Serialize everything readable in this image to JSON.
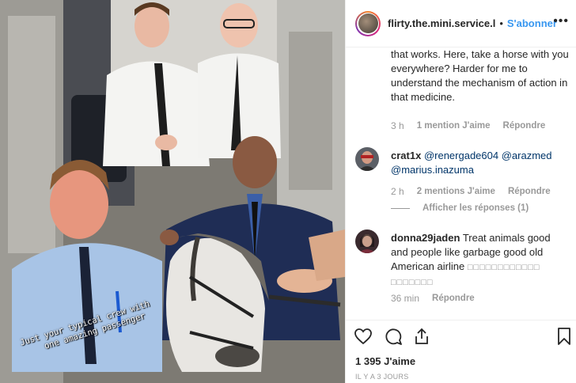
{
  "post": {
    "username": "flirty.the.mini.service.l",
    "separator": "•",
    "follow_label": "S'abonner",
    "more_label": "•••",
    "photo_caption_line1": "Just your typical crew with",
    "photo_caption_line2": "one amazing passenger"
  },
  "comments": [
    {
      "text": "understand. I understand why and how that works. Here, take a horse with you everywhere? Harder for me to understand the mechanism of action in that medicine.",
      "time": "3 h",
      "likes": "1 mention J'aime",
      "reply": "Répondre"
    },
    {
      "username": "crat1x",
      "mention1": "@renergade604",
      "mention2": "@arazmed",
      "mention3": "@marius.inazuma",
      "time": "2 h",
      "likes": "2 mentions J'aime",
      "reply": "Répondre",
      "view_replies": "Afficher les réponses (1)"
    },
    {
      "username": "donna29jaden",
      "text": "Treat animals good and people like garbage good old American airline",
      "emoji": "□□□□□□□□□□□□ □□□□□□□",
      "time": "36 min",
      "reply": "Répondre"
    }
  ],
  "footer": {
    "likes_count": "1 395 J'aime",
    "posted": "IL Y A 3 JOURS"
  },
  "icons": [
    "heart-icon",
    "comment-icon",
    "share-icon",
    "bookmark-icon"
  ],
  "colors": {
    "link": "#3897f0",
    "mention": "#003569",
    "muted": "#999999",
    "text": "#262626"
  }
}
